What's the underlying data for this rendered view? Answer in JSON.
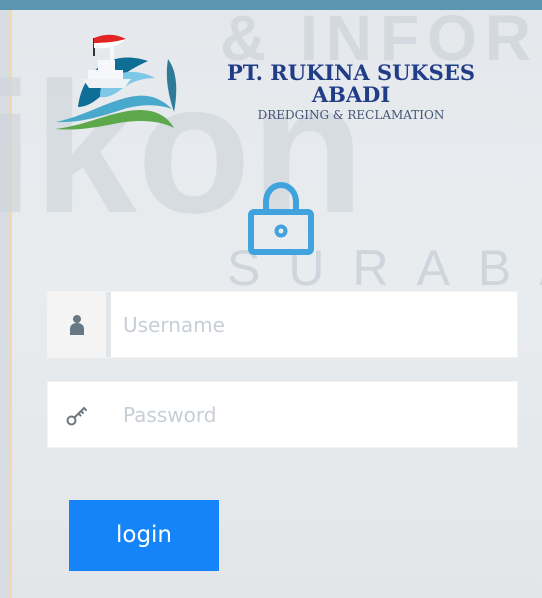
{
  "header": {
    "company_name": "PT. RUKINA SUKSES ABADI",
    "tagline": "DREDGING & RECLAMATION"
  },
  "icons": {
    "company_logo": "ship-logo",
    "lock": "lock-icon",
    "username": "user-icon",
    "password": "key-icon"
  },
  "login_form": {
    "username": {
      "value": "",
      "placeholder": "Username"
    },
    "password": {
      "value": "",
      "placeholder": "Password"
    },
    "submit_label": "login"
  },
  "watermark": {
    "line_1": "& INFORM",
    "line_2": "ikon",
    "line_3": "SURABA"
  },
  "colors": {
    "top_bar": "#5b95b0",
    "brand_text": "#213d87",
    "lock_icon": "#40a3de",
    "button": "#1584f8"
  }
}
